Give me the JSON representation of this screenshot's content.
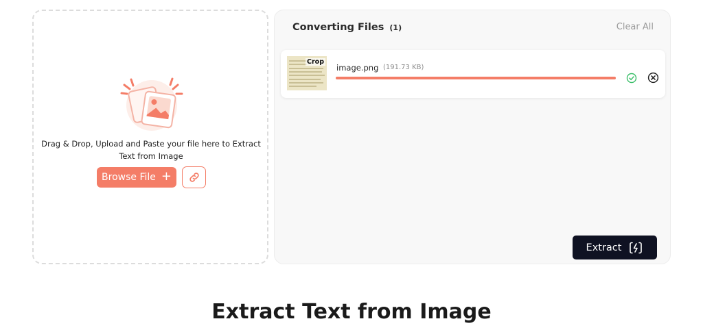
{
  "dropzone": {
    "instructions": "Drag & Drop, Upload and Paste your file here to Extract Text from Image",
    "browse_label": "Browse File",
    "browse_icon": "plus-icon",
    "link_icon": "link-icon",
    "illustration_icon": "image-stack-icon"
  },
  "panel": {
    "title": "Converting Files",
    "count": "(1)",
    "clear_label": "Clear All"
  },
  "file": {
    "crop_label": "Crop",
    "name": "image.png",
    "size": "(191.73 KB)",
    "progress": 1.0,
    "status_icon": "check-circle-icon",
    "remove_icon": "close-circle-icon"
  },
  "extract": {
    "label": "Extract",
    "icon": "bolt-icon"
  },
  "page": {
    "heading": "Extract Text from Image"
  },
  "colors": {
    "accent": "#f47d67",
    "dark_button": "#0f1222",
    "success": "#3cbf6a"
  }
}
